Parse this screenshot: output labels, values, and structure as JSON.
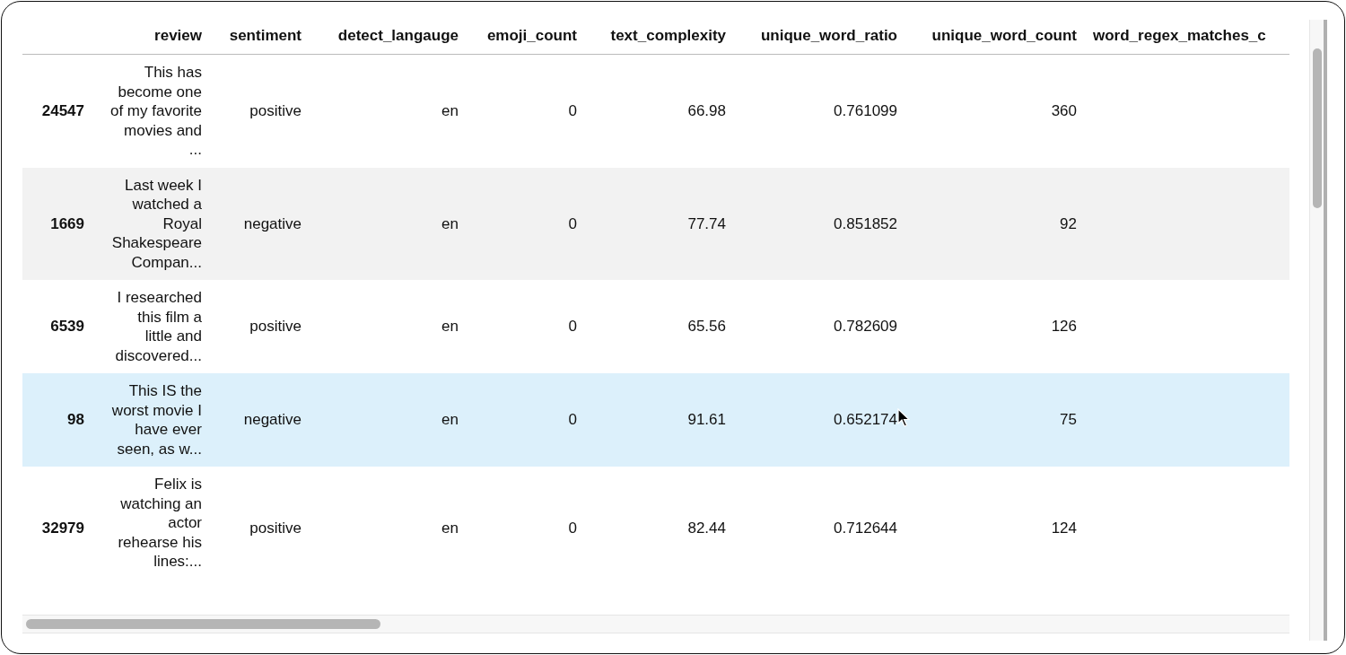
{
  "table": {
    "columns": [
      "review",
      "sentiment",
      "detect_langauge",
      "emoji_count",
      "text_complexity",
      "unique_word_ratio",
      "unique_word_count",
      "word_regex_matches_c"
    ],
    "rows": [
      {
        "index": "24547",
        "highlighted": false,
        "cells": [
          "This has become one of my favorite movies and ...",
          "positive",
          "en",
          "0",
          "66.98",
          "0.761099",
          "360"
        ]
      },
      {
        "index": "1669",
        "highlighted": false,
        "cells": [
          "Last week I watched a Royal Shakespeare Compan...",
          "negative",
          "en",
          "0",
          "77.74",
          "0.851852",
          "92"
        ]
      },
      {
        "index": "6539",
        "highlighted": false,
        "cells": [
          "I researched this film a little and discovered...",
          "positive",
          "en",
          "0",
          "65.56",
          "0.782609",
          "126"
        ]
      },
      {
        "index": "98",
        "highlighted": true,
        "cells": [
          "This IS the worst movie I have ever seen, as w...",
          "negative",
          "en",
          "0",
          "91.61",
          "0.652174",
          "75"
        ]
      },
      {
        "index": "32979",
        "highlighted": false,
        "cells": [
          "Felix is watching an actor rehearse his lines:...",
          "positive",
          "en",
          "0",
          "82.44",
          "0.712644",
          "124"
        ]
      }
    ]
  }
}
